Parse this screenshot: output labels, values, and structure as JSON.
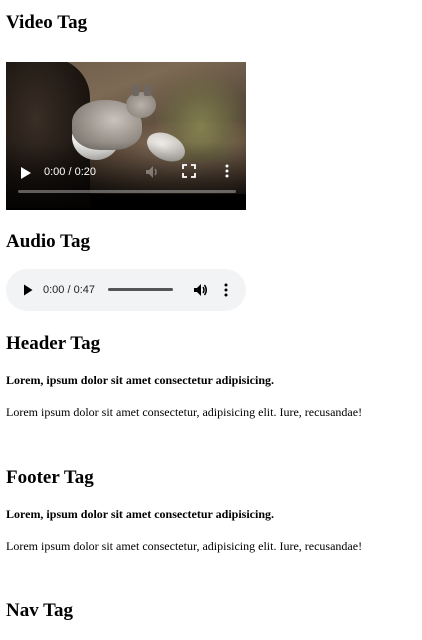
{
  "sections": {
    "video_heading": "Video Tag",
    "audio_heading": "Audio Tag",
    "header_heading": "Header Tag",
    "footer_heading": "Footer Tag",
    "nav_heading": "Nav Tag"
  },
  "video": {
    "time_display": "0:00 / 0:20",
    "progress": 0,
    "icons": [
      "play-icon",
      "volume-icon",
      "fullscreen-icon",
      "more-options-icon"
    ]
  },
  "audio": {
    "time_display": "0:00 / 0:47",
    "volume_level": 1.0,
    "icons": [
      "play-icon",
      "volume-icon",
      "more-options-icon"
    ]
  },
  "header": {
    "bold_text": "Lorem, ipsum dolor sit amet consectetur adipisicing.",
    "paragraph": "Lorem ipsum dolor sit amet consectetur, adipisicing elit. Iure, recusandae!"
  },
  "footer": {
    "bold_text": "Lorem, ipsum dolor sit amet consectetur adipisicing.",
    "paragraph": "Lorem ipsum dolor sit amet consectetur, adipisicing elit. Iure, recusandae!"
  }
}
